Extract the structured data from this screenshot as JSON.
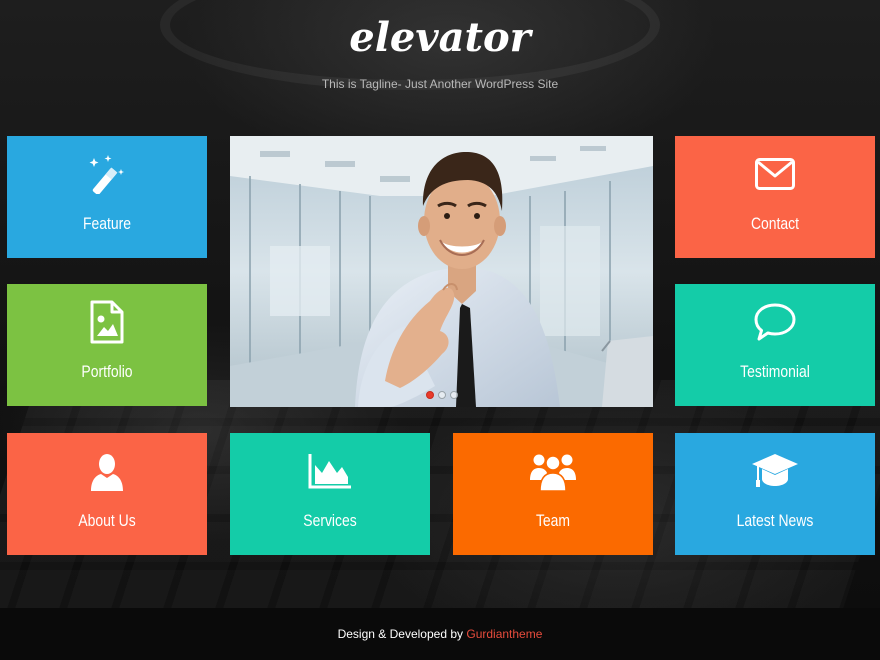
{
  "site": {
    "title": "elevator",
    "tagline": "This is Tagline- Just Another WordPress Site"
  },
  "tiles": [
    {
      "label": "Feature",
      "icon": "magic-wand-icon",
      "color": "#29a8e0"
    },
    {
      "label": "Portfolio",
      "icon": "image-file-icon",
      "color": "#7cc242"
    },
    {
      "label": "About Us",
      "icon": "user-icon",
      "color": "#fb6446"
    },
    {
      "label": "Services",
      "icon": "area-chart-icon",
      "color": "#14cca8"
    },
    {
      "label": "Team",
      "icon": "group-icon",
      "color": "#fb6a00"
    },
    {
      "label": "Contact",
      "icon": "envelope-icon",
      "color": "#fb6446"
    },
    {
      "label": "Testimonial",
      "icon": "speech-bubble-icon",
      "color": "#14cca8"
    },
    {
      "label": "Latest News",
      "icon": "graduation-cap-icon",
      "color": "#29a8e0"
    }
  ],
  "slider": {
    "image": "smiling-businessman-handshake-photo",
    "slides": 3,
    "active_slide": 1,
    "active_dot_color": "#e83a2a"
  },
  "footer": {
    "text": "Design & Developed by",
    "link_label": "Gurdiantheme",
    "link_color": "#e74c3c"
  }
}
